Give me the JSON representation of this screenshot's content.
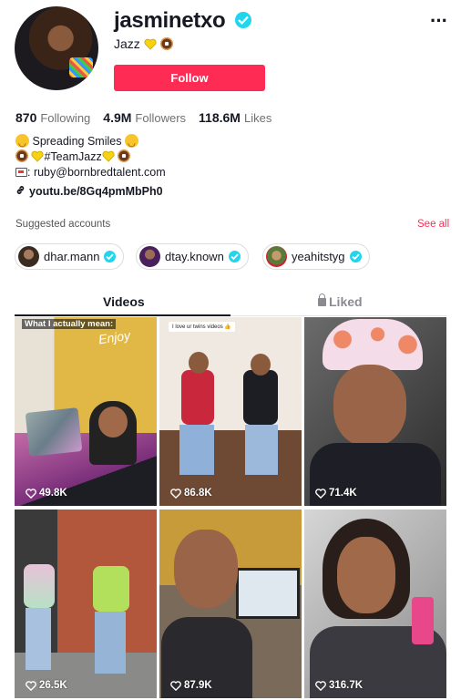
{
  "profile": {
    "username": "jasminetxo",
    "nickname_text": "Jazz",
    "follow_label": "Follow"
  },
  "stats": {
    "following_count": "870",
    "following_label": "Following",
    "followers_count": "4.9M",
    "followers_label": "Followers",
    "likes_count": "118.6M",
    "likes_label": "Likes"
  },
  "bio": {
    "line1": "Spreading Smiles",
    "line2": "#TeamJazz",
    "email": ": ruby@bornbredtalent.com",
    "link": "youtu.be/8Gq4pmMbPh0"
  },
  "suggested": {
    "title": "Suggested accounts",
    "see_all": "See all",
    "accounts": [
      {
        "name": "dhar.mann",
        "avatar_color": "#6b4a3a"
      },
      {
        "name": "dtay.known",
        "avatar_color": "#5a2a6e"
      },
      {
        "name": "yeahitstyg",
        "avatar_color": "#8a6a4a"
      }
    ]
  },
  "tabs": {
    "videos": "Videos",
    "liked": "Liked"
  },
  "videos": [
    {
      "views": "49.8K",
      "caption": "What I actually mean:",
      "sign": "Enjoy"
    },
    {
      "views": "86.8K",
      "sticker": "I love ur twins videos 👍"
    },
    {
      "views": "71.4K"
    },
    {
      "views": "26.5K"
    },
    {
      "views": "87.9K"
    },
    {
      "views": "316.7K"
    }
  ],
  "colors": {
    "brand": "#fe2c55",
    "verified": "#20d5ec",
    "text": "#161823",
    "muted": "#707070"
  }
}
